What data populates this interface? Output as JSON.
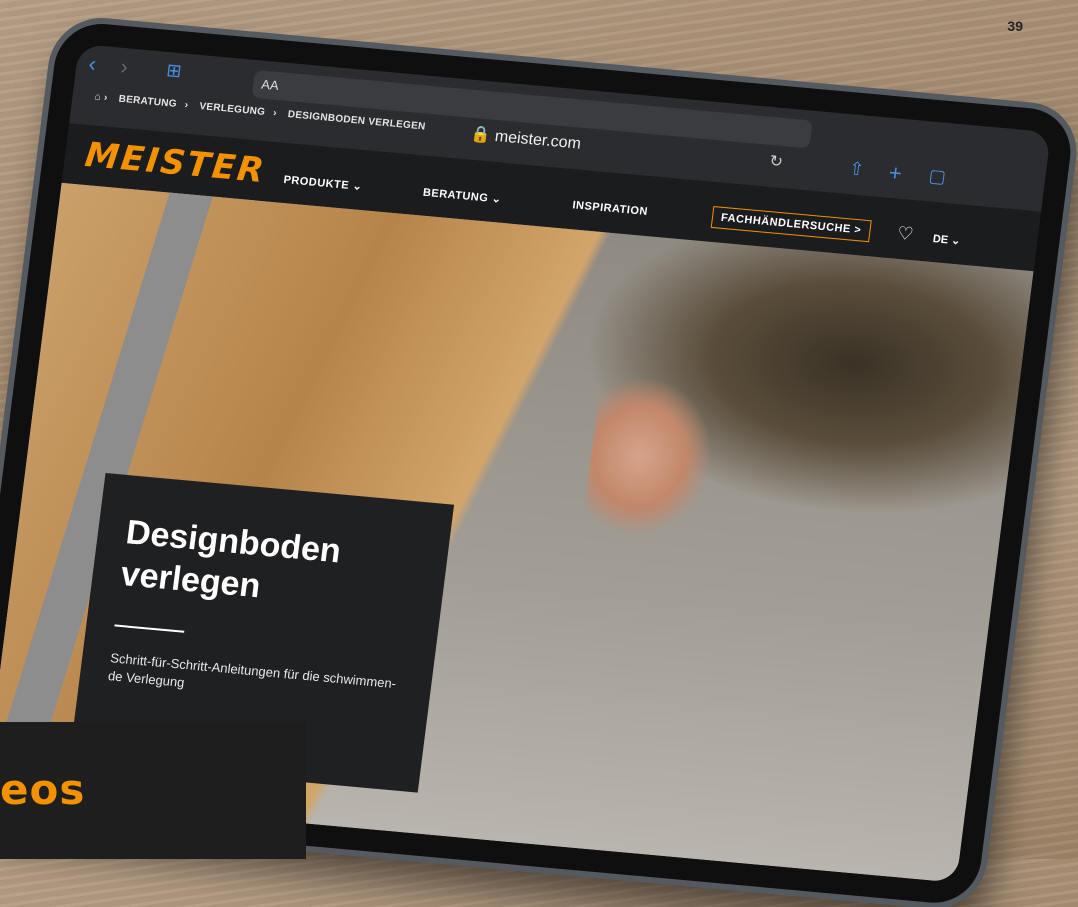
{
  "page_number": "39",
  "promo_text": "eos",
  "browser": {
    "aa_label": "AA",
    "url": "meister.com",
    "breadcrumb": [
      "BERATUNG",
      "VERLEGUNG",
      "DESIGNBODEN VERLEGEN"
    ]
  },
  "site": {
    "logo": "MEISTER",
    "nav": [
      "PRODUKTE",
      "BERATUNG",
      "INSPIRATION"
    ],
    "dealer_button": "FACHHÄNDLERSUCHE >",
    "lang": "DE"
  },
  "hero": {
    "title": "Designboden verlegen",
    "subtitle": "Schritt-für-Schritt-Anleitungen für die schwimmen-de Verlegung"
  },
  "colors": {
    "brand": "#f39200",
    "dark": "#1f2022"
  }
}
